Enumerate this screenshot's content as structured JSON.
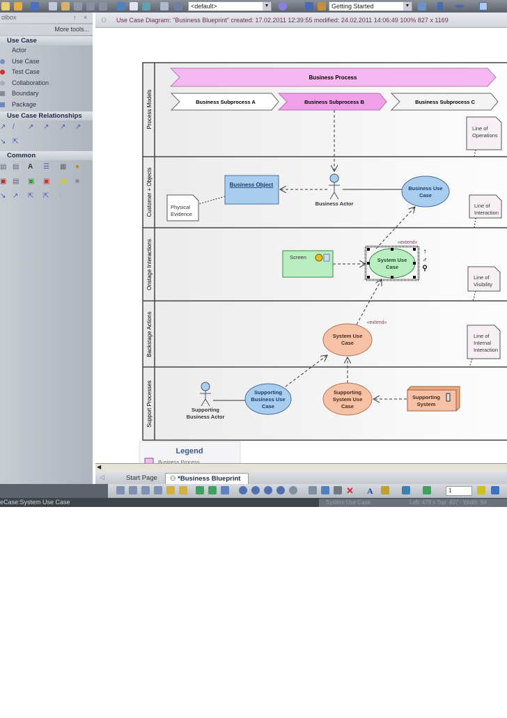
{
  "toolbar": {
    "view_combo": "<default>",
    "workspace_combo": "Getting Started"
  },
  "toolbox": {
    "title": "olbox",
    "pin": "↑",
    "close": "×",
    "more_tools": "More tools...",
    "sections": [
      {
        "label": "Use Case",
        "items": [
          "Actor",
          "Use Case",
          "Test Case",
          "Collaboration",
          "Boundary",
          "Package"
        ]
      },
      {
        "label": "Use Case Relationships"
      },
      {
        "label": "Common"
      }
    ]
  },
  "diagram_header": {
    "text": "Use Case Diagram: \"Business Blueprint\"  created: 17.02.2011 12:39:55  modified: 24.02.2011 14:06:49   100%   827 x 1169"
  },
  "diagram": {
    "lanes": [
      "Process Models",
      "Customer + Objects",
      "Onstage Interactions",
      "Backstage Actions",
      "Support Processes"
    ],
    "business_process": "Business Process",
    "subprocesses": [
      "Business Subprocess A",
      "Business Subprocess B",
      "Business Subprocess C"
    ],
    "notes": {
      "operations": [
        "Line of",
        "Operations"
      ],
      "interaction": [
        "Line of",
        "Interaction"
      ],
      "visibility": [
        "Line of",
        "Visibility"
      ],
      "internal": [
        "Line of",
        "Internal",
        "Interaction"
      ],
      "physical": [
        "Physical",
        "Evidence"
      ]
    },
    "business_object": "Business Object",
    "business_actor": "Business Actor",
    "business_use_case": [
      "Business Use",
      "Case"
    ],
    "screen": "Screen",
    "system_use_case_green": [
      "System Use",
      "Case"
    ],
    "system_use_case_orange": [
      "System Use",
      "Case"
    ],
    "extend_label": "«extend»",
    "supporting_actor": [
      "Supporting",
      "Business Actor"
    ],
    "supporting_business_use_case": [
      "Supporting",
      "Business Use",
      "Case"
    ],
    "supporting_system_use_case": [
      "Supporting",
      "System Use",
      "Case"
    ],
    "supporting_system": [
      "Supporting",
      "System"
    ],
    "legend": {
      "title": "Legend",
      "items": [
        "Business Process"
      ]
    },
    "colors": {
      "process": "#f7b7f0",
      "blue": "#a9cdef",
      "green": "#b9efc0",
      "orange": "#f6c1a4"
    }
  },
  "tabs": [
    "Start Page",
    "*Business Blueprint"
  ],
  "zoom_field": "1",
  "status": {
    "left": "eCase:System Use Case",
    "element": "System Use Case",
    "position": "Left:  479 x Top:  407 - Width:  84"
  }
}
